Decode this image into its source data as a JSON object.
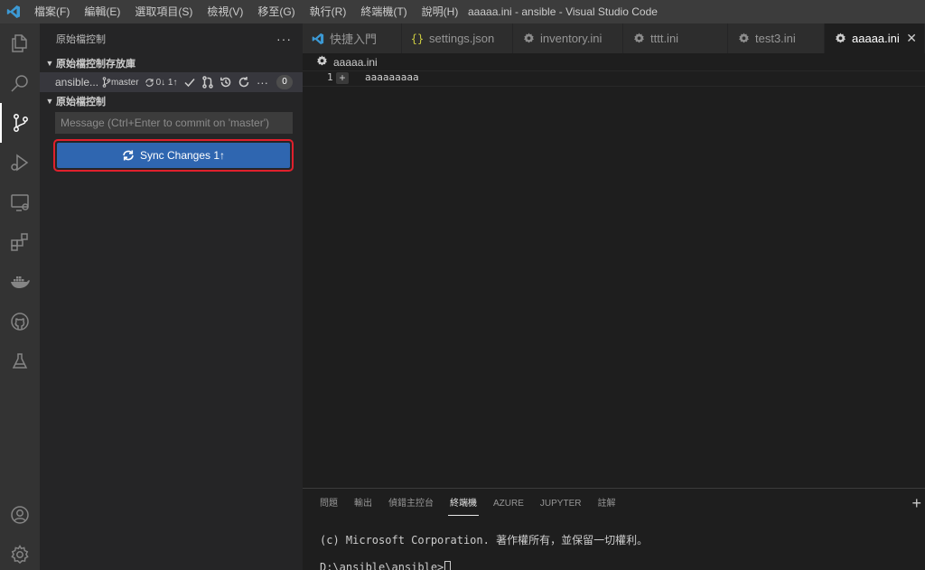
{
  "menu": [
    "檔案(F)",
    "編輯(E)",
    "選取項目(S)",
    "檢視(V)",
    "移至(G)",
    "執行(R)",
    "終端機(T)",
    "說明(H)"
  ],
  "window_title": "aaaaa.ini - ansible - Visual Studio Code",
  "activity_icons": [
    "explorer-icon",
    "search-icon",
    "source-control-icon",
    "run-debug-icon",
    "remote-explorer-icon",
    "extensions-icon",
    "docker-icon",
    "github-icon",
    "test-icon",
    "account-icon",
    "settings-gear-icon"
  ],
  "sidebar": {
    "title": "原始檔控制",
    "more": "···",
    "repos_section": "原始檔控制存放庫",
    "repo": {
      "name": "ansible...",
      "branch": "master",
      "sync": "0↓ 1↑",
      "badge": "0"
    },
    "scm_section": "原始檔控制",
    "commit_placeholder": "Message (Ctrl+Enter to commit on 'master')",
    "sync_button": "Sync Changes 1↑"
  },
  "tabs": [
    {
      "label": "快捷入門",
      "icon": "vscode-icon"
    },
    {
      "label": "settings.json",
      "icon": "json-braces-icon"
    },
    {
      "label": "inventory.ini",
      "icon": "gear-icon"
    },
    {
      "label": "tttt.ini",
      "icon": "gear-icon"
    },
    {
      "label": "test3.ini",
      "icon": "gear-icon"
    },
    {
      "label": "aaaaa.ini",
      "icon": "gear-icon",
      "active": true
    }
  ],
  "tab_close": "✕",
  "editor": {
    "breadcrumb": "aaaaa.ini",
    "line_number": "1",
    "line_text": "aaaaaaaaa"
  },
  "panel": {
    "tabs": [
      "問題",
      "輸出",
      "偵錯主控台",
      "終端機",
      "AZURE",
      "JUPYTER",
      "註解"
    ],
    "active_tab": "終端機",
    "plus": "+",
    "terminal_lines": [
      "(c) Microsoft Corporation. 著作權所有，並保留一切權利。",
      "D:\\ansible\\ansible>"
    ]
  },
  "colors": {
    "accent_button": "#2f66b0",
    "highlight_border": "#e0202c",
    "vscode_blue": "#3c99d4",
    "json_yellow": "#cbcb41"
  }
}
